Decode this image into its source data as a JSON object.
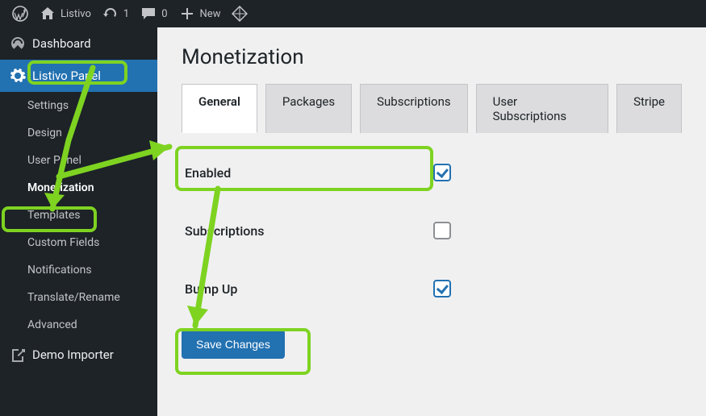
{
  "adminbar": {
    "site_title": "Listivo",
    "updates_count": "1",
    "comments_count": "0",
    "new_label": "New"
  },
  "sidebar": {
    "items": [
      {
        "label": "Dashboard"
      },
      {
        "label": "Listivo Panel"
      },
      {
        "label": "Demo Importer"
      }
    ],
    "submenu": [
      {
        "label": "Settings"
      },
      {
        "label": "Design"
      },
      {
        "label": "User Panel"
      },
      {
        "label": "Monetization"
      },
      {
        "label": "Templates"
      },
      {
        "label": "Custom Fields"
      },
      {
        "label": "Notifications"
      },
      {
        "label": "Translate/Rename"
      },
      {
        "label": "Advanced"
      }
    ]
  },
  "page": {
    "title": "Monetization",
    "tabs": [
      {
        "label": "General"
      },
      {
        "label": "Packages"
      },
      {
        "label": "Subscriptions"
      },
      {
        "label": "User Subscriptions"
      },
      {
        "label": "Stripe"
      }
    ],
    "fields": {
      "enabled_label": "Enabled",
      "subscriptions_label": "Subscriptions",
      "bumpup_label": "Bump Up"
    },
    "save_label": "Save Changes"
  },
  "colors": {
    "accent": "#2271b1",
    "highlight": "#7ed321"
  }
}
